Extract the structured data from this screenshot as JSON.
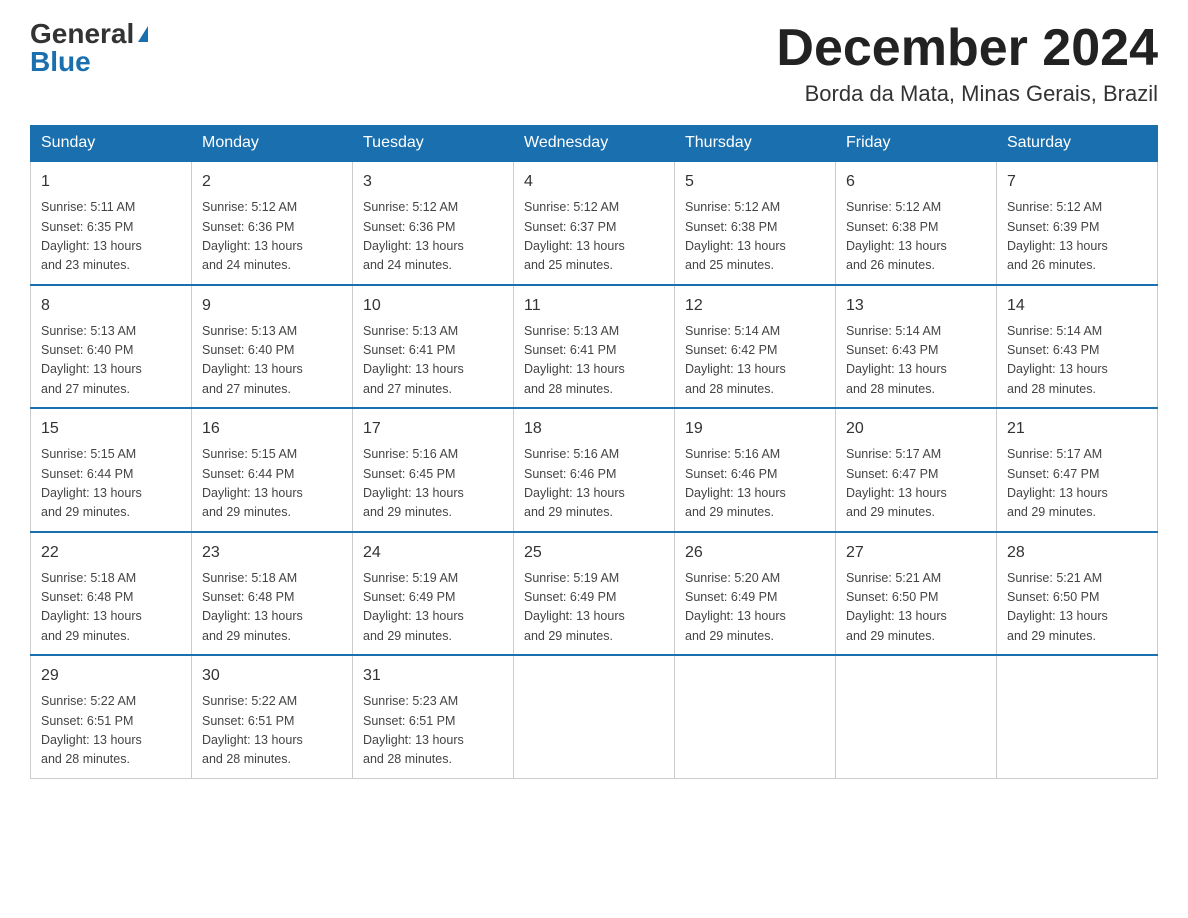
{
  "header": {
    "logo_general": "General",
    "logo_blue": "Blue",
    "month_title": "December 2024",
    "location": "Borda da Mata, Minas Gerais, Brazil"
  },
  "weekdays": [
    "Sunday",
    "Monday",
    "Tuesday",
    "Wednesday",
    "Thursday",
    "Friday",
    "Saturday"
  ],
  "weeks": [
    [
      {
        "day": "1",
        "sunrise": "5:11 AM",
        "sunset": "6:35 PM",
        "daylight": "13 hours and 23 minutes."
      },
      {
        "day": "2",
        "sunrise": "5:12 AM",
        "sunset": "6:36 PM",
        "daylight": "13 hours and 24 minutes."
      },
      {
        "day": "3",
        "sunrise": "5:12 AM",
        "sunset": "6:36 PM",
        "daylight": "13 hours and 24 minutes."
      },
      {
        "day": "4",
        "sunrise": "5:12 AM",
        "sunset": "6:37 PM",
        "daylight": "13 hours and 25 minutes."
      },
      {
        "day": "5",
        "sunrise": "5:12 AM",
        "sunset": "6:38 PM",
        "daylight": "13 hours and 25 minutes."
      },
      {
        "day": "6",
        "sunrise": "5:12 AM",
        "sunset": "6:38 PM",
        "daylight": "13 hours and 26 minutes."
      },
      {
        "day": "7",
        "sunrise": "5:12 AM",
        "sunset": "6:39 PM",
        "daylight": "13 hours and 26 minutes."
      }
    ],
    [
      {
        "day": "8",
        "sunrise": "5:13 AM",
        "sunset": "6:40 PM",
        "daylight": "13 hours and 27 minutes."
      },
      {
        "day": "9",
        "sunrise": "5:13 AM",
        "sunset": "6:40 PM",
        "daylight": "13 hours and 27 minutes."
      },
      {
        "day": "10",
        "sunrise": "5:13 AM",
        "sunset": "6:41 PM",
        "daylight": "13 hours and 27 minutes."
      },
      {
        "day": "11",
        "sunrise": "5:13 AM",
        "sunset": "6:41 PM",
        "daylight": "13 hours and 28 minutes."
      },
      {
        "day": "12",
        "sunrise": "5:14 AM",
        "sunset": "6:42 PM",
        "daylight": "13 hours and 28 minutes."
      },
      {
        "day": "13",
        "sunrise": "5:14 AM",
        "sunset": "6:43 PM",
        "daylight": "13 hours and 28 minutes."
      },
      {
        "day": "14",
        "sunrise": "5:14 AM",
        "sunset": "6:43 PM",
        "daylight": "13 hours and 28 minutes."
      }
    ],
    [
      {
        "day": "15",
        "sunrise": "5:15 AM",
        "sunset": "6:44 PM",
        "daylight": "13 hours and 29 minutes."
      },
      {
        "day": "16",
        "sunrise": "5:15 AM",
        "sunset": "6:44 PM",
        "daylight": "13 hours and 29 minutes."
      },
      {
        "day": "17",
        "sunrise": "5:16 AM",
        "sunset": "6:45 PM",
        "daylight": "13 hours and 29 minutes."
      },
      {
        "day": "18",
        "sunrise": "5:16 AM",
        "sunset": "6:46 PM",
        "daylight": "13 hours and 29 minutes."
      },
      {
        "day": "19",
        "sunrise": "5:16 AM",
        "sunset": "6:46 PM",
        "daylight": "13 hours and 29 minutes."
      },
      {
        "day": "20",
        "sunrise": "5:17 AM",
        "sunset": "6:47 PM",
        "daylight": "13 hours and 29 minutes."
      },
      {
        "day": "21",
        "sunrise": "5:17 AM",
        "sunset": "6:47 PM",
        "daylight": "13 hours and 29 minutes."
      }
    ],
    [
      {
        "day": "22",
        "sunrise": "5:18 AM",
        "sunset": "6:48 PM",
        "daylight": "13 hours and 29 minutes."
      },
      {
        "day": "23",
        "sunrise": "5:18 AM",
        "sunset": "6:48 PM",
        "daylight": "13 hours and 29 minutes."
      },
      {
        "day": "24",
        "sunrise": "5:19 AM",
        "sunset": "6:49 PM",
        "daylight": "13 hours and 29 minutes."
      },
      {
        "day": "25",
        "sunrise": "5:19 AM",
        "sunset": "6:49 PM",
        "daylight": "13 hours and 29 minutes."
      },
      {
        "day": "26",
        "sunrise": "5:20 AM",
        "sunset": "6:49 PM",
        "daylight": "13 hours and 29 minutes."
      },
      {
        "day": "27",
        "sunrise": "5:21 AM",
        "sunset": "6:50 PM",
        "daylight": "13 hours and 29 minutes."
      },
      {
        "day": "28",
        "sunrise": "5:21 AM",
        "sunset": "6:50 PM",
        "daylight": "13 hours and 29 minutes."
      }
    ],
    [
      {
        "day": "29",
        "sunrise": "5:22 AM",
        "sunset": "6:51 PM",
        "daylight": "13 hours and 28 minutes."
      },
      {
        "day": "30",
        "sunrise": "5:22 AM",
        "sunset": "6:51 PM",
        "daylight": "13 hours and 28 minutes."
      },
      {
        "day": "31",
        "sunrise": "5:23 AM",
        "sunset": "6:51 PM",
        "daylight": "13 hours and 28 minutes."
      },
      null,
      null,
      null,
      null
    ]
  ]
}
